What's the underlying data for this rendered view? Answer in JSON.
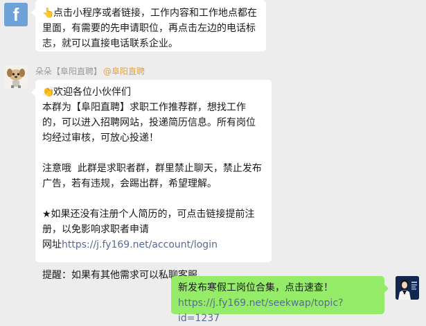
{
  "messages": {
    "m1": {
      "emoji": "👆",
      "text": "点击小程序或者链接，工作内容和工作地点都在里面，有需要的先申请职位，再点击左边的电话标志，就可以直接电话联系企业。"
    },
    "m2": {
      "sender_name": "朵朵【阜阳直聘】",
      "sender_mention": "@阜阳直聘",
      "emoji": "👏",
      "line1": "欢迎各位小伙伴们",
      "para1": "本群为【阜阳直聘】求职工作推荐群，想找工作的，可以进入招聘网站，投递简历信息。所有岗位均经过审核，可放心投递！",
      "para2": "注意哦  此群是求职者群，群里禁止聊天，禁止发布广告，若有违规，会踢出群，希望理解。",
      "para3": "★如果还没有注册个人简历的，可点击链接提前注册，以免影响求职者申请",
      "url_prefix": "网址",
      "url": "https://j.fy169.net/account/login",
      "para4": "提醒：如果有其他需求可以私聊客服"
    },
    "m3": {
      "text": "新发布寒假工岗位合集，点击速查！",
      "url": "https://j.fy169.net/seekwap/topic?id=1237"
    }
  },
  "avatars": {
    "top": "facebook-logo",
    "sender": "dog-cartoon",
    "self": "woman-portrait"
  },
  "colors": {
    "background": "#ededed",
    "incoming_bubble": "#ffffff",
    "outgoing_bubble": "#95ec69",
    "link": "#576b95",
    "mention": "#e6a23c",
    "sender_name": "#9a9a9a"
  }
}
